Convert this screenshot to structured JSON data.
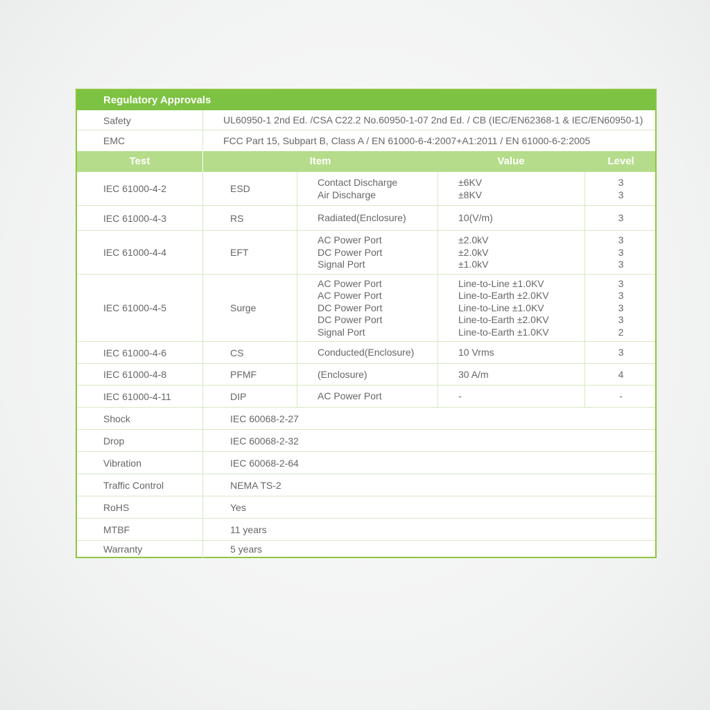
{
  "title": "Regulatory Approvals",
  "safety": {
    "label": "Safety",
    "value": "UL60950-1 2nd Ed. /CSA C22.2 No.60950-1-07 2nd Ed. / CB (IEC/EN62368-1 & IEC/EN60950-1)"
  },
  "emc": {
    "label": "EMC",
    "value": "FCC Part 15, Subpart B, Class A / EN 61000-6-4:2007+A1:2011 / EN 61000-6-2:2005"
  },
  "columns": {
    "test": "Test",
    "item": "Item",
    "value": "Value",
    "level": "Level"
  },
  "tests": [
    {
      "std": "IEC 61000-4-2",
      "code": "ESD",
      "items": [
        "Contact Discharge",
        "Air Discharge"
      ],
      "values": [
        "±6KV",
        "±8KV"
      ],
      "levels": [
        "3",
        "3"
      ]
    },
    {
      "std": "IEC 61000-4-3",
      "code": "RS",
      "items": [
        "Radiated(Enclosure)"
      ],
      "values": [
        "10(V/m)"
      ],
      "levels": [
        "3"
      ]
    },
    {
      "std": "IEC 61000-4-4",
      "code": "EFT",
      "items": [
        "AC Power Port",
        "DC Power Port",
        "Signal Port"
      ],
      "values": [
        "±2.0kV",
        "±2.0kV",
        "±1.0kV"
      ],
      "levels": [
        "3",
        "3",
        "3"
      ]
    },
    {
      "std": "IEC 61000-4-5",
      "code": "Surge",
      "items": [
        "AC Power Port",
        "AC Power Port",
        "DC Power Port",
        "DC Power Port",
        "Signal Port"
      ],
      "values": [
        "Line-to-Line ±1.0KV",
        "Line-to-Earth ±2.0KV",
        "Line-to-Line ±1.0KV",
        "Line-to-Earth ±2.0KV",
        "Line-to-Earth ±1.0KV"
      ],
      "levels": [
        "3",
        "3",
        "3",
        "3",
        "2"
      ]
    },
    {
      "std": "IEC 61000-4-6",
      "code": "CS",
      "items": [
        "Conducted(Enclosure)"
      ],
      "values": [
        "10 Vrms"
      ],
      "levels": [
        "3"
      ]
    },
    {
      "std": "IEC 61000-4-8",
      "code": "PFMF",
      "items": [
        "(Enclosure)"
      ],
      "values": [
        "30 A/m"
      ],
      "levels": [
        "4"
      ]
    },
    {
      "std": "IEC 61000-4-11",
      "code": "DIP",
      "items": [
        "AC Power Port"
      ],
      "values": [
        "-"
      ],
      "levels": [
        "-"
      ]
    }
  ],
  "specs": [
    {
      "label": "Shock",
      "value": "IEC 60068-2-27"
    },
    {
      "label": "Drop",
      "value": "IEC 60068-2-32"
    },
    {
      "label": "Vibration",
      "value": "IEC 60068-2-64"
    },
    {
      "label": "Traffic Control",
      "value": "NEMA TS-2"
    },
    {
      "label": "RoHS",
      "value": "Yes"
    },
    {
      "label": "MTBF",
      "value": "11 years"
    },
    {
      "label": "Warranty",
      "value": "5 years"
    }
  ]
}
